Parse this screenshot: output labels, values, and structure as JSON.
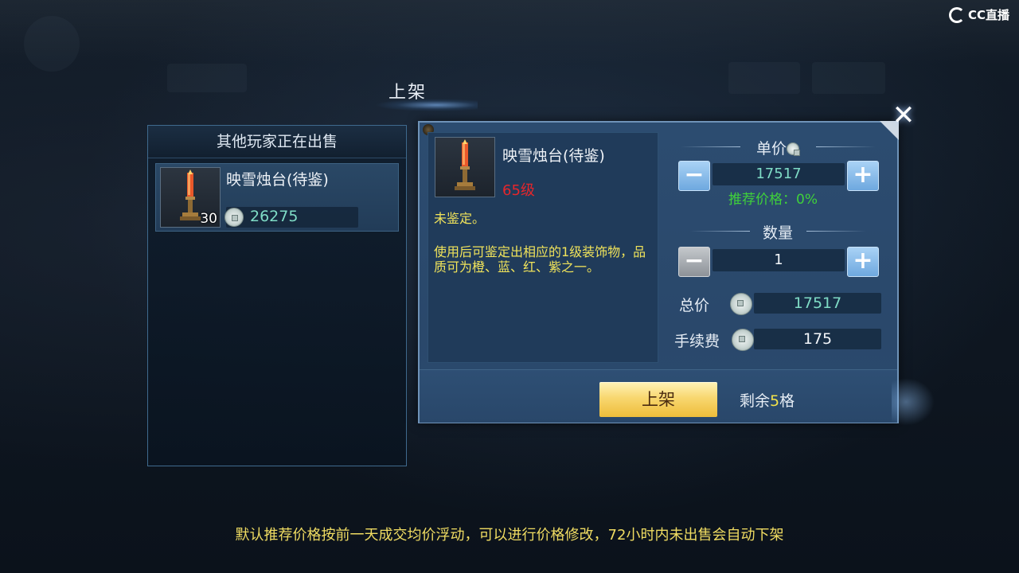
{
  "watermark": {
    "brand": "CC直播"
  },
  "dialog": {
    "title": "上架",
    "close_symbol": "✕"
  },
  "left_panel": {
    "title": "其他玩家正在出售",
    "listings": [
      {
        "name": "映雪烛台(待鉴)",
        "count": "30",
        "price": "26275"
      }
    ]
  },
  "item": {
    "name": "映雪烛台(待鉴)",
    "level": "65级",
    "status": "未鉴定。",
    "description": "使用后可鉴定出相应的1级装饰物，品质可为橙、蓝、红、紫之一。"
  },
  "pricing": {
    "unit_price_label": "单价",
    "unit_price": "17517",
    "recommend_hint": "推荐价格：0%",
    "quantity_label": "数量",
    "quantity": "1",
    "total_label": "总价",
    "total": "17517",
    "fee_label": "手续费",
    "fee": "175",
    "minus_symbol": "−",
    "plus_symbol": "+"
  },
  "footer": {
    "list_button": "上架",
    "remaining_prefix": "剩余",
    "remaining_count": "5",
    "remaining_suffix": "格"
  },
  "notice": "默认推荐价格按前一天成交均价浮动，可以进行价格修改，72小时内未出售会自动下架",
  "colors": {
    "price_green": "#7fdcc6",
    "hint_green": "#3fd13a",
    "level_red": "#e5262b",
    "desc_yellow": "#f0e35a",
    "button_gold": "#f8d770"
  },
  "icons": [
    "close-icon",
    "coin-icon",
    "candlestick-icon",
    "minus-icon",
    "plus-icon"
  ]
}
